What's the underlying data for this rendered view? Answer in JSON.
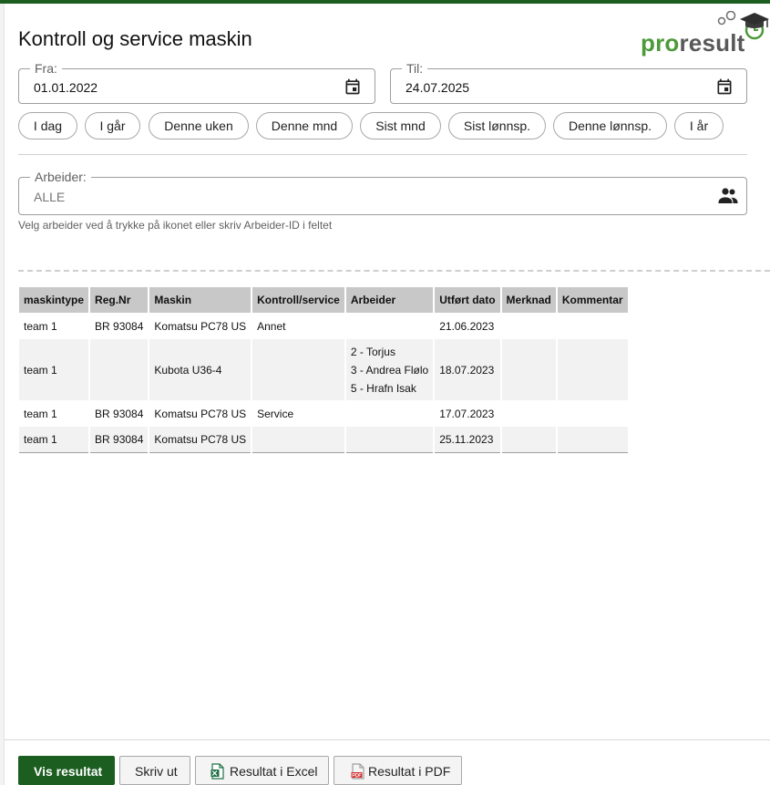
{
  "page": {
    "title": "Kontroll og service maskin"
  },
  "logo": {
    "part1": "pro",
    "part2": "result"
  },
  "filters": {
    "from": {
      "label": "Fra:",
      "value": "01.01.2022"
    },
    "to": {
      "label": "Til:",
      "value": "24.07.2025"
    },
    "presets": [
      "I dag",
      "I går",
      "Denne uken",
      "Denne mnd",
      "Sist mnd",
      "Sist lønnsp.",
      "Denne lønnsp.",
      "I år"
    ],
    "worker": {
      "label": "Arbeider:",
      "value": "ALLE",
      "helper": "Velg arbeider ved å trykke på ikonet eller skriv Arbeider-ID i feltet"
    }
  },
  "table": {
    "columns": [
      "maskintype",
      "Reg.Nr",
      "Maskin",
      "Kontroll/service",
      "Arbeider",
      "Utført dato",
      "Merknad",
      "Kommentar"
    ],
    "rows": [
      {
        "maskintype": "team 1",
        "regnr": "BR 93084",
        "maskin": "Komatsu PC78 US",
        "kontroll": "Annet",
        "arbeider": [],
        "dato": "21.06.2023",
        "merknad": "",
        "kommentar": ""
      },
      {
        "maskintype": "team 1",
        "regnr": "",
        "maskin": "Kubota U36-4",
        "kontroll": "",
        "arbeider": [
          "2 - Torjus",
          "3 - Andrea Flølo",
          "5 - Hrafn Isak"
        ],
        "dato": "18.07.2023",
        "merknad": "",
        "kommentar": ""
      },
      {
        "maskintype": "team 1",
        "regnr": "BR 93084",
        "maskin": "Komatsu PC78 US",
        "kontroll": "Service",
        "arbeider": [],
        "dato": "17.07.2023",
        "merknad": "",
        "kommentar": ""
      },
      {
        "maskintype": "team 1",
        "regnr": "BR 93084",
        "maskin": "Komatsu PC78 US",
        "kontroll": "",
        "arbeider": [],
        "dato": "25.11.2023",
        "merknad": "",
        "kommentar": ""
      }
    ]
  },
  "actions": {
    "show": "Vis resultat",
    "print": "Skriv ut",
    "excel": "Resultat i Excel",
    "pdf": "Resultat i PDF"
  },
  "icons": {
    "from_calendar": "calendar-icon",
    "to_calendar": "calendar-icon",
    "worker_picker": "people-icon",
    "excel": "excel-file-icon",
    "pdf": "pdf-file-icon",
    "logo": "graduation-cap-clock-icon"
  },
  "colors": {
    "brand_green": "#1b5e20",
    "logo_green": "#4d9a3a",
    "logo_grey": "#595959",
    "header_grey": "#c8c8c8"
  }
}
